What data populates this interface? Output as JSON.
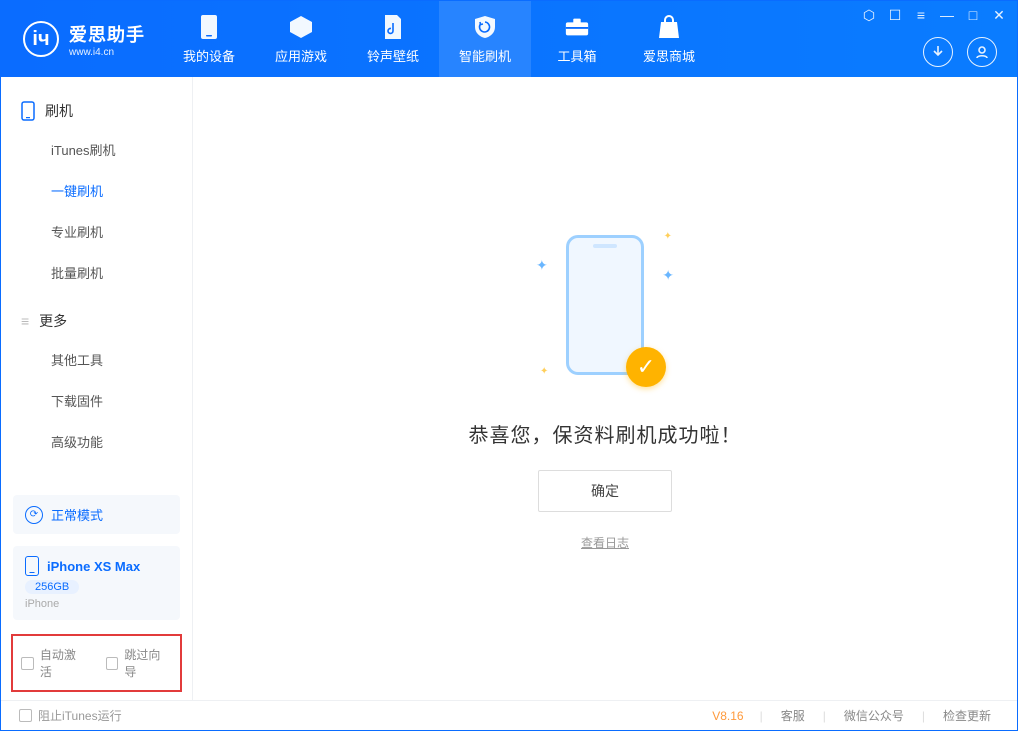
{
  "app": {
    "title": "爱思助手",
    "subtitle": "www.i4.cn"
  },
  "nav": {
    "items": [
      {
        "label": "我的设备"
      },
      {
        "label": "应用游戏"
      },
      {
        "label": "铃声壁纸"
      },
      {
        "label": "智能刷机",
        "active": true
      },
      {
        "label": "工具箱"
      },
      {
        "label": "爱思商城"
      }
    ]
  },
  "sidebar": {
    "group1": {
      "title": "刷机",
      "items": [
        "iTunes刷机",
        "一键刷机",
        "专业刷机",
        "批量刷机"
      ],
      "activeIndex": 1
    },
    "group2": {
      "title": "更多",
      "items": [
        "其他工具",
        "下载固件",
        "高级功能"
      ]
    },
    "mode": {
      "label": "正常模式"
    },
    "device": {
      "name": "iPhone XS Max",
      "storage": "256GB",
      "type": "iPhone"
    },
    "options": {
      "autoActivate": "自动激活",
      "skipGuide": "跳过向导"
    }
  },
  "main": {
    "successText": "恭喜您，保资料刷机成功啦！",
    "okButton": "确定",
    "viewLog": "查看日志"
  },
  "footer": {
    "blockItunes": "阻止iTunes运行",
    "version": "V8.16",
    "links": [
      "客服",
      "微信公众号",
      "检查更新"
    ]
  }
}
